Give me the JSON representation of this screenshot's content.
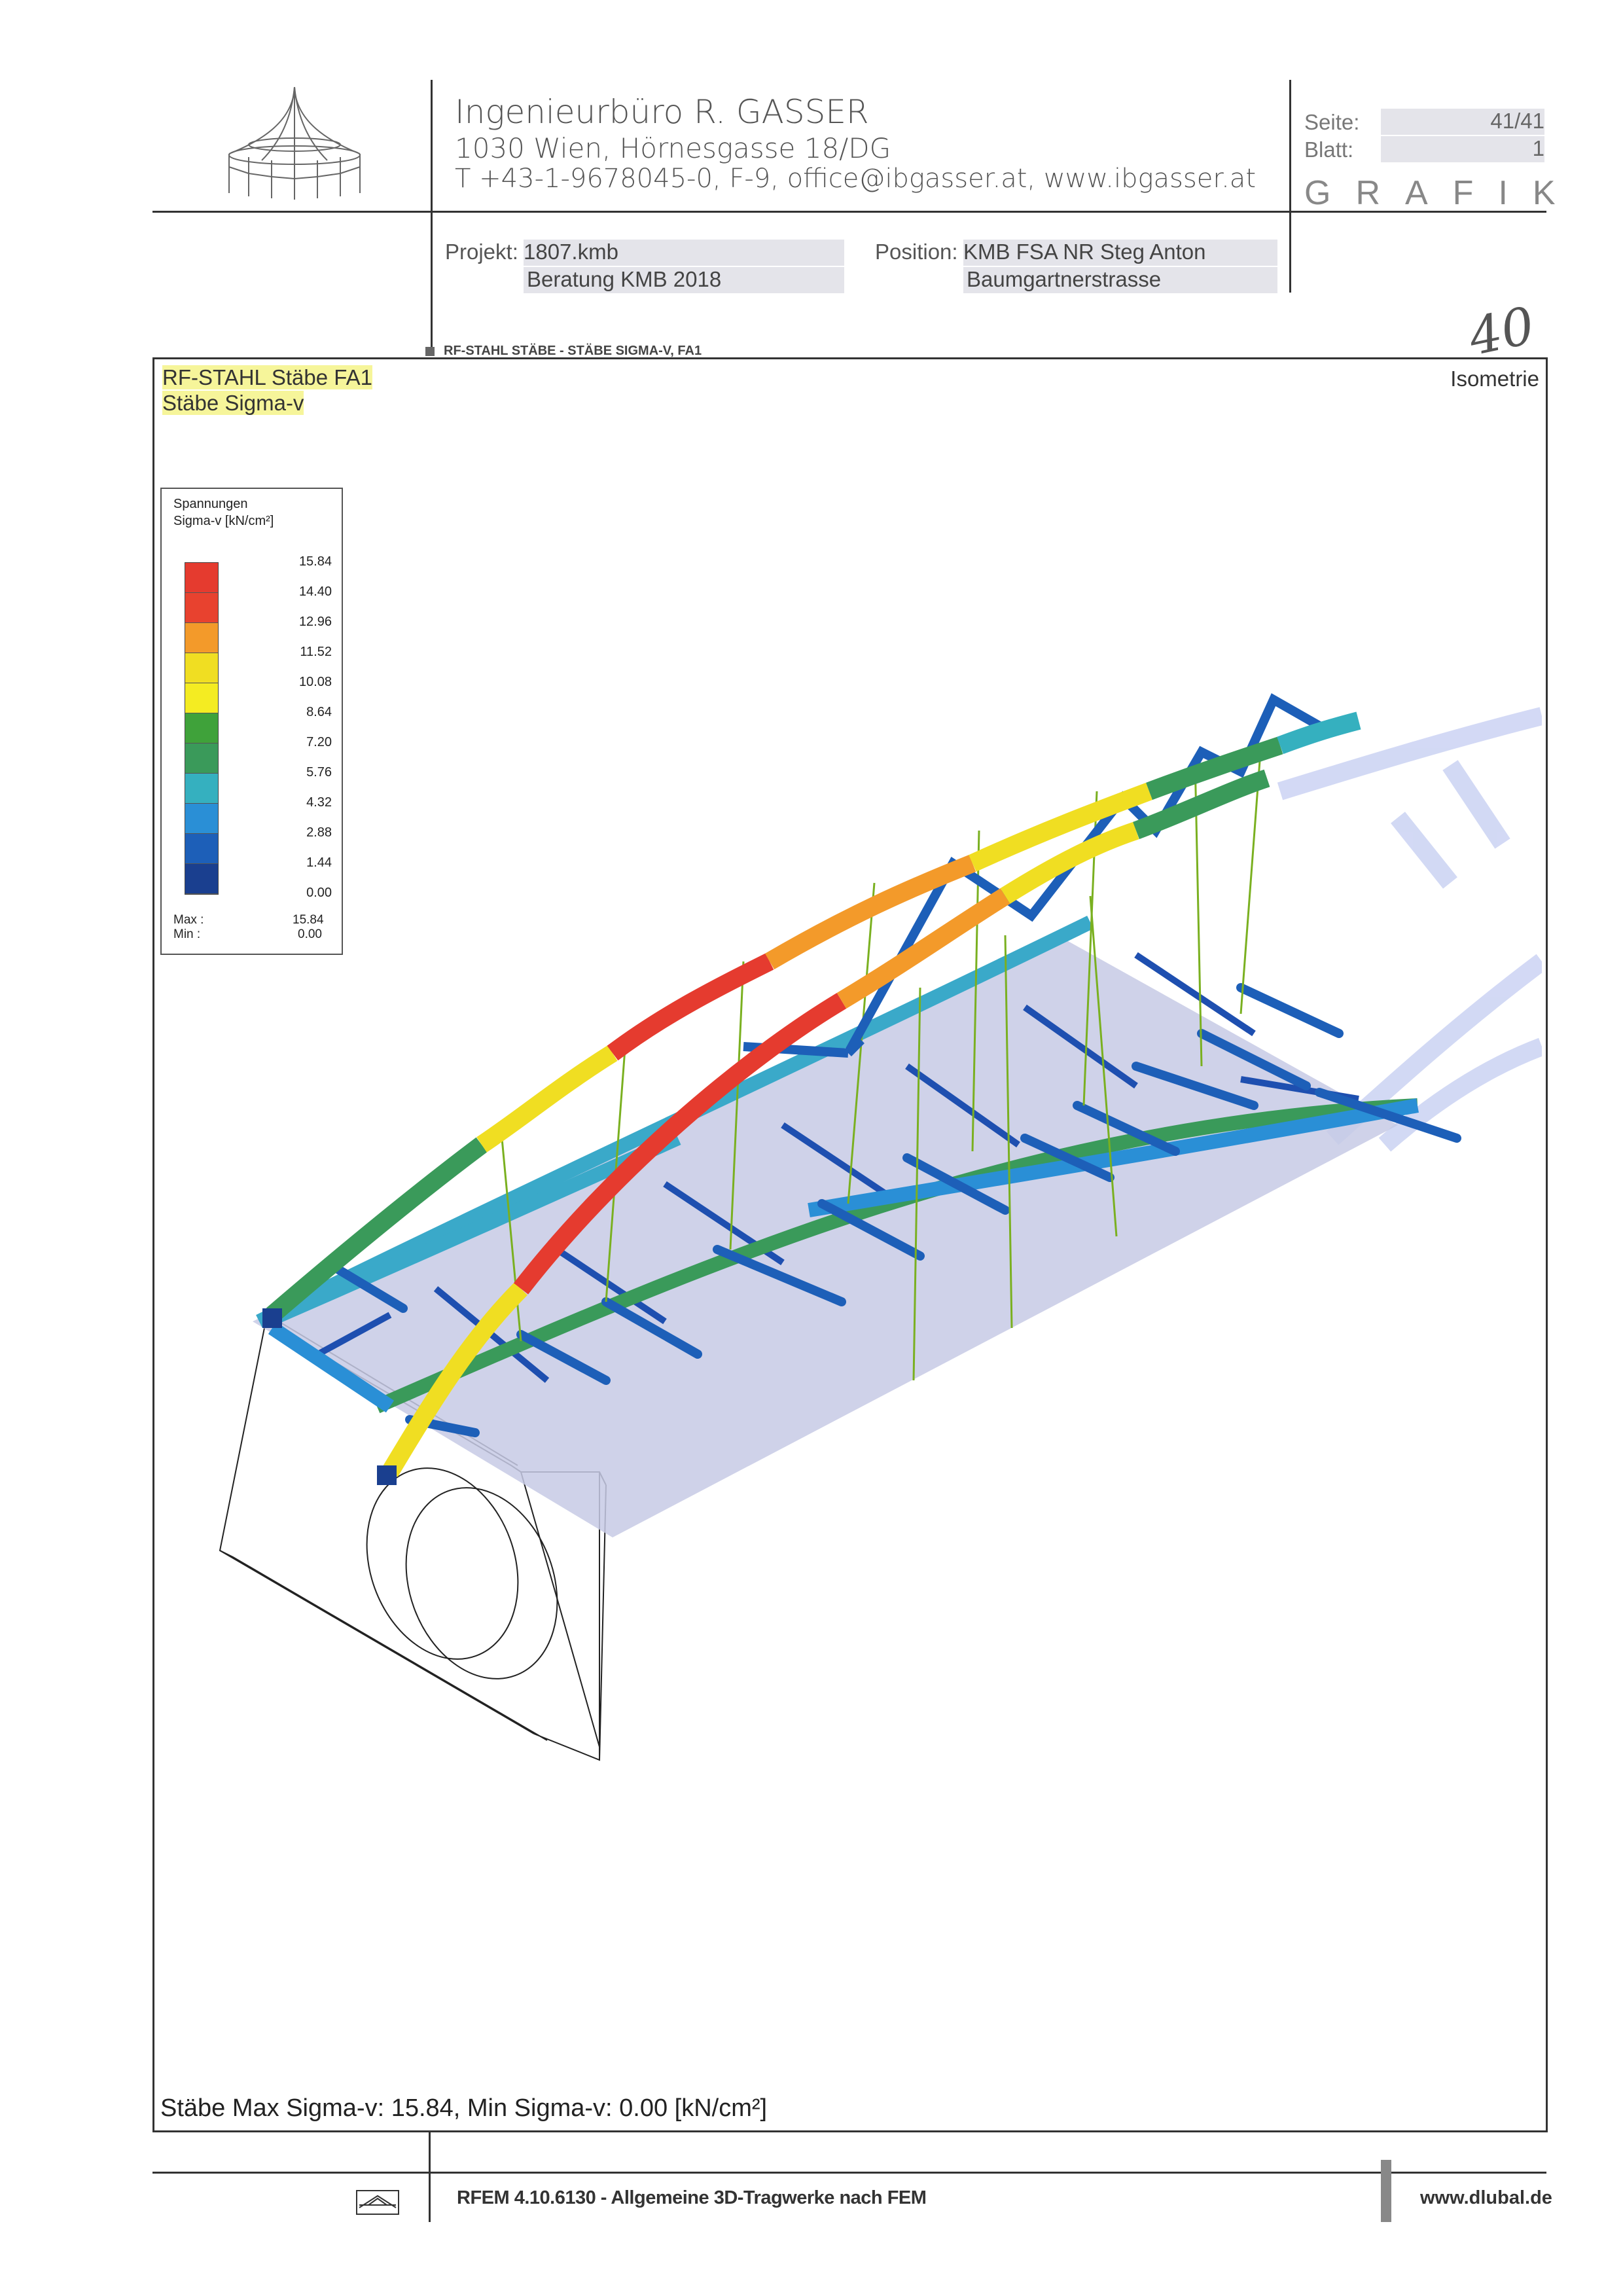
{
  "header": {
    "company_name": "Ingenieurbüro R. GASSER",
    "address": "1030 Wien, Hörnesgasse 18/DG",
    "contact": "T +43-1-9678045-0,  F-9,  office@ibgasser.at,  www.ibgasser.at",
    "seite_label": "Seite:",
    "seite_value": "41/41",
    "blatt_label": "Blatt:",
    "blatt_value": "1",
    "grafik_label": "GRAFIK",
    "projekt_label": "Projekt:",
    "projekt_value1": "1807.kmb",
    "projekt_value2": "Beratung KMB 2018",
    "position_label": "Position:",
    "position_value1": "KMB FSA NR Steg Anton",
    "position_value2": "Baumgartnerstrasse",
    "handwritten_number": "40"
  },
  "figure": {
    "caption_tag": "RF-STAHL STÄBE - STÄBE SIGMA-V, FA1",
    "title_line1": "RF-STAHL Stäbe FA1",
    "title_line2": "Stäbe Sigma-v",
    "view_label": "Isometrie",
    "summary": "Stäbe Max Sigma-v: 15.84, Min Sigma-v: 0.00 [kN/cm²]"
  },
  "legend": {
    "title_line1": "Spannungen",
    "title_line2": "Sigma-v [kN/cm²]",
    "values": [
      "15.84",
      "14.40",
      "12.96",
      "11.52",
      "10.08",
      "8.64",
      "7.20",
      "5.76",
      "4.32",
      "2.88",
      "1.44",
      "0.00"
    ],
    "colors": [
      "#e53b2f",
      "#e8422f",
      "#f39a2a",
      "#f0de22",
      "#f4ec22",
      "#3fa23a",
      "#3a9a5a",
      "#35b0bf",
      "#2a8fd6",
      "#1d5fb8",
      "#1a3f8f"
    ],
    "max_label": "Max :",
    "max_value": "15.84",
    "min_label": "Min :",
    "min_value": "0.00"
  },
  "footer": {
    "software": "RFEM 4.10.6130 - Allgemeine 3D-Tragwerke nach FEM",
    "website": "www.dlubal.de"
  }
}
